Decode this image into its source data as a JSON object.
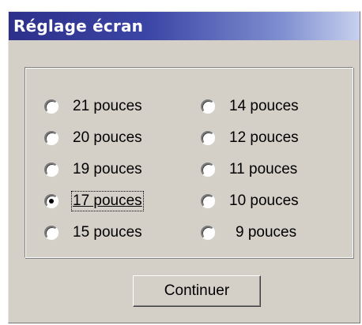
{
  "window": {
    "title": "Réglage écran"
  },
  "options": {
    "left": [
      {
        "label": "21 pouces",
        "checked": false
      },
      {
        "label": "20 pouces",
        "checked": false
      },
      {
        "label": "19 pouces",
        "checked": false
      },
      {
        "label": "17 pouces",
        "checked": true,
        "focused": true
      },
      {
        "label": "15 pouces",
        "checked": false
      }
    ],
    "right": [
      {
        "label": "14 pouces",
        "checked": false
      },
      {
        "label": "12 pouces",
        "checked": false
      },
      {
        "label": "11 pouces",
        "checked": false
      },
      {
        "label": "10 pouces",
        "checked": false
      },
      {
        "label": "9 pouces",
        "checked": false
      }
    ]
  },
  "continue_button": {
    "label": "Continuer"
  }
}
